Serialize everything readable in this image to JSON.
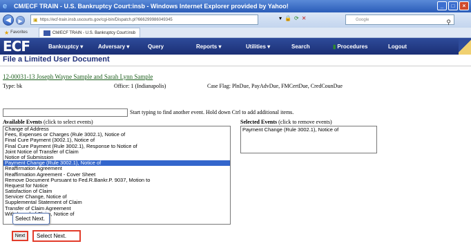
{
  "window": {
    "title": "CM/ECF TRAIN - U.S. Bankruptcy Court:insb - Windows Internet Explorer provided by Yahoo!",
    "controls": {
      "minimize": "_",
      "maximize": "□",
      "close": "×"
    }
  },
  "address_bar": {
    "url": "https://ecf-train.insb.uscourts.gov/cgi-bin/Dispatch.pl?666299986049345",
    "search_placeholder": "Google"
  },
  "favorites_bar": {
    "favorites_label": "Favorites",
    "tab_label": "CM/ECF TRAIN - U.S. Bankruptcy Court:insb"
  },
  "ecf_menu": {
    "logo": "ECF",
    "items": [
      "Bankruptcy ▾",
      "Adversary ▾",
      "Query",
      "Reports ▾",
      "Utilities ▾",
      "Search",
      "Procedures",
      "Logout"
    ]
  },
  "page": {
    "title": "File a Limited User Document",
    "case_link": "12-00031-13 Joseph Wayne Sample and Sarah Lynn Sample",
    "type_line": "Type: bk",
    "office_line": "Office: 1 (Indianapolis)",
    "case_flag": "Case Flag: PlnDue, PayAdvDue, FMCertDue, CredCounDue",
    "find_hint": "Start typing to find another event. Hold down Ctrl to add additional items.",
    "available_heading": "Available Events",
    "available_note": " (click to select events)",
    "selected_heading": "Selected Events",
    "selected_note": " (click to remove events)",
    "available_events": [
      "Change of Address",
      "Fees, Expenses or Charges (Rule 3002.1), Notice of",
      "Final Cure Payment (3002.1), Notice of",
      "Final Cure Payment (Rule 3002.1), Response to Notice of",
      "Joint Notice of Transfer of Claim",
      "Notice of Submission",
      "Payment Change (Rule 3002.1), Notice of",
      "Reaffirmation Agreement",
      "Reaffirmation Agreement - Cover Sheet",
      "Remove Document Pursuant to Fed.R.Bankr.P. 9037, Motion to",
      "Request for Notice",
      "Satisfaction of Claim",
      "Servicer Change, Notice of",
      "Supplemental Statement of Claim",
      "Transfer of Claim Agreement",
      "Withdrawal of Claim, Notice of"
    ],
    "selected_index": 6,
    "selected_events": [
      "Payment Change (Rule 3002.1), Notice of"
    ],
    "tooltip": "Select Next.",
    "next_button": "Next",
    "callout": "Select Next."
  },
  "colors": {
    "ecf_bar": "#1b2f75",
    "title_blue": "#1f2f7a",
    "link_green": "#1a5d1a",
    "selection": "#3366cc",
    "highlight_red": "#e23b2a"
  }
}
